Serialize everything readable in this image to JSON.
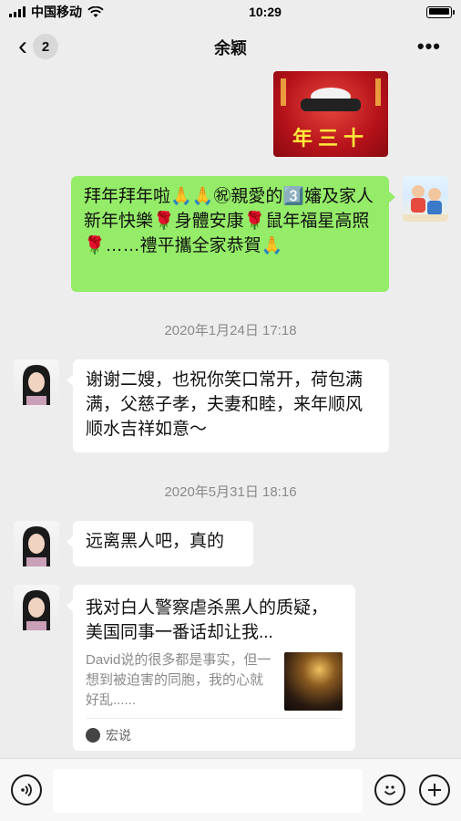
{
  "status": {
    "carrier": "中国移动",
    "time": "10:29"
  },
  "nav": {
    "back_badge": "2",
    "title": "余颖",
    "more": "•••"
  },
  "messages": {
    "poster_text": "年三十",
    "greeting": "拜年拜年啦🙏🙏㊗親愛的3️⃣嬸及家人新年快樂🌹身體安康🌹鼠年福星高照🌹……禮平攜全家恭賀🙏",
    "time1": "2020年1月24日 17:18",
    "reply1": "谢谢二嫂，也祝你笑口常开，荷包满满，父慈子孝，夫妻和睦，来年顺风顺水吉祥如意～",
    "time2": "2020年5月31日 18:16",
    "reply2": "远离黑人吧，真的",
    "card": {
      "title": "我对白人警察虐杀黑人的质疑，美国同事一番话却让我...",
      "desc": "David说的很多都是事实，但一想到被迫害的同胞，我的心就好乱......",
      "source": "宏说"
    }
  },
  "icons": {
    "voice": "voice-icon",
    "emoji": "emoji-icon",
    "plus": "plus-icon",
    "wifi": "wifi-icon",
    "back": "chevron-left-icon",
    "more": "more-icon"
  },
  "colors": {
    "chat_bg": "#ededed",
    "self_bubble": "#95ec69",
    "other_bubble": "#ffffff",
    "timestamp": "#8a8a8a"
  }
}
